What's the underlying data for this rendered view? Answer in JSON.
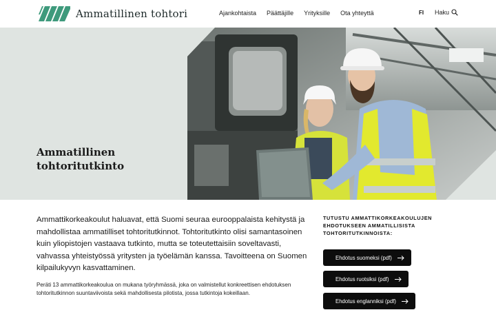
{
  "header": {
    "logo_text": "Ammatillinen tohtori",
    "nav": [
      "Ajankohtaista",
      "Päättäjille",
      "Yrityksille",
      "Ota yhteyttä"
    ],
    "language": "FI",
    "search_label": "Haku"
  },
  "hero": {
    "title_line1": "Ammatillinen",
    "title_line2": "tohtoritutkinto"
  },
  "main": {
    "lead": "Ammattikorkeakoulut haluavat, että Suomi seuraa eurooppalaista kehitystä ja mahdollistaa ammatilliset tohtoritutkinnot. Tohtoritutkinto olisi samantasoinen kuin yliopistojen vastaava tutkinto, mutta se toteutettaisiin soveltavasti, vahvassa yhteistyössä yritysten ja työelämän kanssa. Tavoitteena on Suomen kilpailukyvyn kasvattaminen.",
    "body": "Peräti 13 ammattikorkeakoulua on mukana työryhmässä, joka on valmistellut konkreettisen ehdotuksen tohtoritutkinnon suuntaviivoista sekä mahdollisesta pilotista, jossa tutkintoja kokeillaan."
  },
  "side": {
    "heading": "TUTUSTU AMMATTIKORKEAKOULUJEN EHDOTUKSEEN AMMATILLISISTA TOHTORITUTKINNOISTA:",
    "buttons": [
      "Ehdotus suomeksi (pdf)",
      "Ehdotus ruotsiksi (pdf)",
      "Ehdotus englanniksi (pdf)"
    ]
  },
  "colors": {
    "brand_green": "#3e9a7c",
    "hero_bg": "#dfe4e1",
    "button_bg": "#0d0d0d"
  },
  "icons": {
    "logo": "brand-stripes-icon",
    "search": "search-icon",
    "arrow": "arrow-right-icon"
  }
}
